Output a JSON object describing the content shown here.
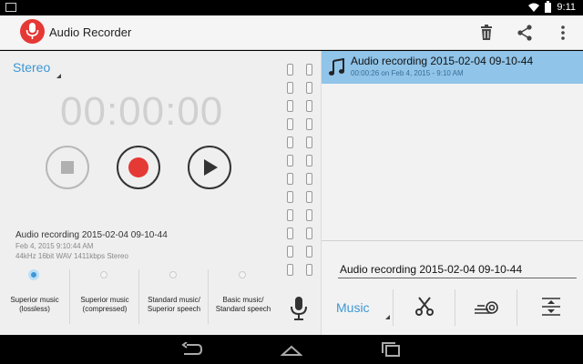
{
  "statusbar": {
    "time": "9:11"
  },
  "actionbar": {
    "title": "Audio Recorder",
    "icons": [
      "mic-icon",
      "delete-icon",
      "share-icon",
      "overflow-menu-icon"
    ]
  },
  "recorder": {
    "channel_mode": "Stereo",
    "timer": "00:00:00",
    "controls": [
      "stop",
      "record",
      "play"
    ],
    "current_recording": {
      "title": "Audio recording 2015-02-04 09-10-44",
      "date": "Feb 4, 2015 9:10:44 AM",
      "format": "44kHz 16bit WAV 1411kbps Stereo"
    },
    "quality_options": [
      {
        "label": "Superior music (lossless)",
        "selected": true
      },
      {
        "label": "Superior music (compressed)",
        "selected": false
      },
      {
        "label": "Standard music/ Superior speech",
        "selected": false
      },
      {
        "label": "Basic music/ Standard speech",
        "selected": false
      }
    ]
  },
  "recordings": {
    "items": [
      {
        "title": "Audio recording 2015-02-04 09-10-44",
        "subtitle": "00:00:26 on Feb 4, 2015 - 9:10 AM",
        "selected": true
      }
    ]
  },
  "editor": {
    "name_value": "Audio recording 2015-02-04 09-10-44",
    "category": "Music",
    "tools": [
      "scissors-icon",
      "effects-icon",
      "trim-icon"
    ]
  },
  "colors": {
    "accent": "#3d98d6",
    "record": "#e53935",
    "selection": "#90c4e8"
  }
}
